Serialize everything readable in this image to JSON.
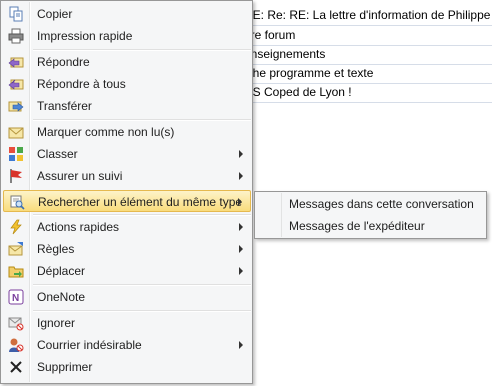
{
  "mail_list": {
    "rows": [
      "RE: Re: RE: La lettre d'information de Philippe M",
      "ure forum",
      "enseignements",
      "iche programme et texte",
      "DS Coped de Lyon !"
    ]
  },
  "context_menu": {
    "items": [
      {
        "label": "Copier",
        "icon": "copy-icon"
      },
      {
        "label": "Impression rapide",
        "icon": "printer-icon"
      },
      {
        "label": "Répondre",
        "icon": "reply-icon"
      },
      {
        "label": "Répondre à tous",
        "icon": "reply-all-icon"
      },
      {
        "label": "Transférer",
        "icon": "forward-icon"
      },
      {
        "label": "Marquer comme non lu(s)",
        "icon": "unread-mail-icon"
      },
      {
        "label": "Classer",
        "icon": "categorize-icon"
      },
      {
        "label": "Assurer un suivi",
        "icon": "flag-icon"
      },
      {
        "label": "Rechercher un élément du même type",
        "icon": "find-related-icon"
      },
      {
        "label": "Actions rapides",
        "icon": "lightning-icon"
      },
      {
        "label": "Règles",
        "icon": "rules-icon"
      },
      {
        "label": "Déplacer",
        "icon": "move-folder-icon"
      },
      {
        "label": "OneNote",
        "icon": "onenote-icon"
      },
      {
        "label": "Ignorer",
        "icon": "ignore-icon"
      },
      {
        "label": "Courrier indésirable",
        "icon": "junk-mail-icon"
      },
      {
        "label": "Supprimer",
        "icon": "delete-icon"
      }
    ]
  },
  "submenu": {
    "items": [
      {
        "label": "Messages dans cette conversation"
      },
      {
        "label": "Messages de l'expéditeur"
      }
    ]
  },
  "colors": {
    "menu_bg": "#f5f6f7",
    "highlight_top": "#fdf3c9",
    "highlight_bottom": "#f9dc7c",
    "highlight_border": "#e5b94f"
  }
}
